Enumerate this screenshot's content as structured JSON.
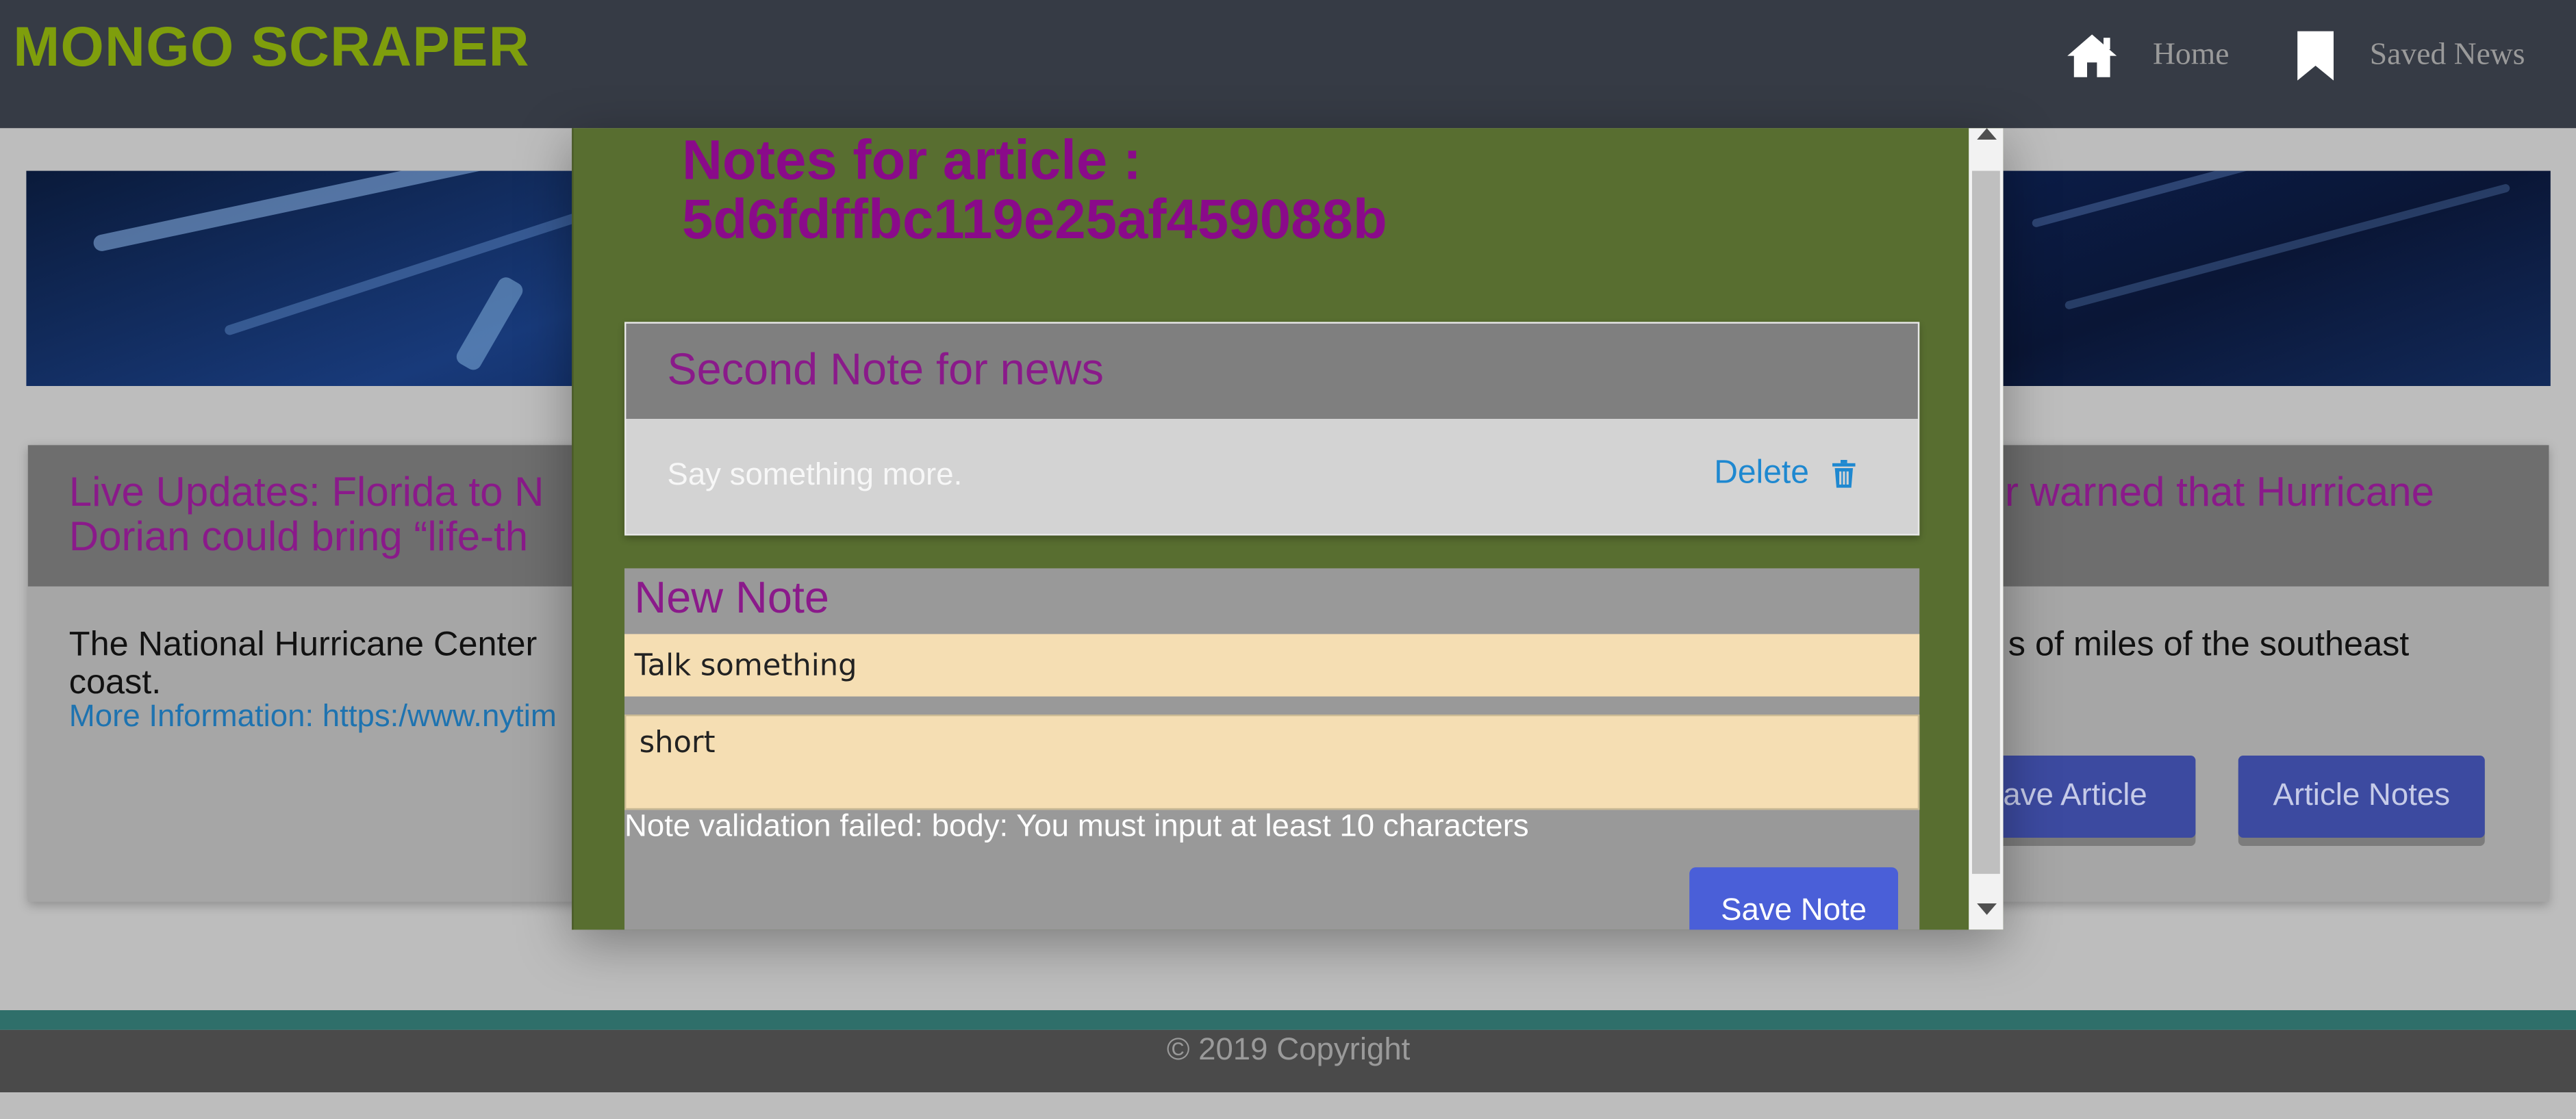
{
  "navbar": {
    "brand": "MONGO SCRAPER",
    "links": [
      {
        "label": "Home",
        "icon": "home-icon"
      },
      {
        "label": "Saved News",
        "icon": "bookmark-icon"
      }
    ]
  },
  "article": {
    "title": "Live Updates: Florida to N… warned that Hurricane Dorian could bring “life-th…",
    "title_left_line1": "Live Updates: Florida to N",
    "title_left_line2": "Dorian could bring “life-th",
    "title_right": "r warned that Hurricane",
    "text_left_line1": "The National Hurricane Center",
    "text_left_line2": "coast.",
    "text_right": "s of miles of the southeast",
    "link": "More Information: https:/www.nytim",
    "save_button": "save Article",
    "notes_button": "Article Notes"
  },
  "footer": {
    "copyright": "© 2019 Copyright"
  },
  "modal": {
    "title_line1": "Notes for article :",
    "title_line2": "5d6fdffbc119e25af459088b",
    "notes": [
      {
        "title": "Second Note for news",
        "body": "Say something more.",
        "delete_label": "Delete",
        "delete_icon": "trash-icon"
      }
    ],
    "new_note": {
      "heading": "New Note",
      "title_value": "Talk something",
      "body_value": "short",
      "validation_error": "Note validation failed: body: You must input at least 10 characters",
      "save_button": "Save Note"
    }
  },
  "colors": {
    "navbar": "#363b45",
    "brand": "#7f9e0c",
    "modal_bg": "#586e30",
    "accent_purple": "#8a1a8a",
    "link_blue": "#1e88d0",
    "input_bg": "#f5deb3",
    "primary_button": "#4a5fd8"
  }
}
